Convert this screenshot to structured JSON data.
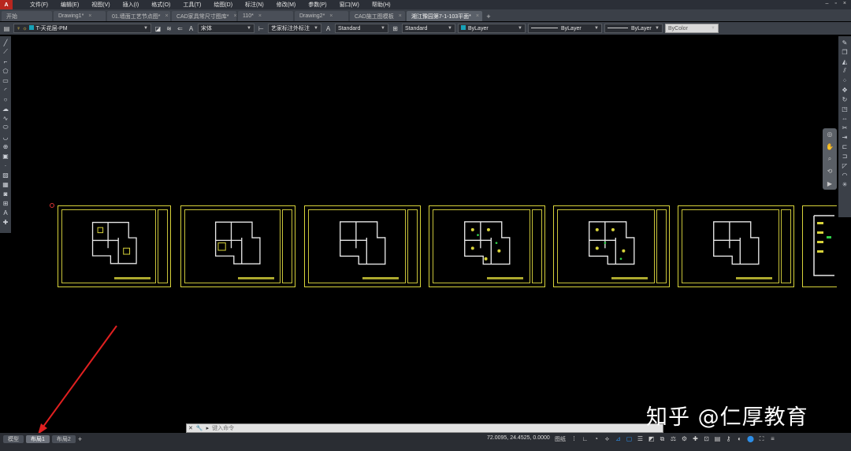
{
  "menubar": {
    "logo": "A",
    "items": [
      "文件(F)",
      "编辑(E)",
      "视图(V)",
      "插入(I)",
      "格式(O)",
      "工具(T)",
      "绘图(D)",
      "标注(N)",
      "修改(M)",
      "参数(P)",
      "窗口(W)",
      "帮助(H)"
    ],
    "window_controls": [
      "–",
      "▫",
      "×"
    ]
  },
  "tabs": {
    "items": [
      {
        "label": "开始",
        "width": 64
      },
      {
        "label": "Drawing1*",
        "width": 66
      },
      {
        "label": "01.墙面工艺节点图*",
        "width": 80
      },
      {
        "label": "CAD家具常尺寸图库*",
        "width": 82
      },
      {
        "label": "110*",
        "width": 70
      },
      {
        "label": "Drawing2*",
        "width": 68
      },
      {
        "label": "CAD施工图模板",
        "width": 70
      },
      {
        "label": "湘江豫园第7-1-103平面*",
        "width": 96,
        "active": true
      }
    ],
    "add": "+"
  },
  "toolbar": {
    "layer": "T-天花层-PM",
    "font": "宋体",
    "dimstyle": "艺家标注外标注",
    "textstyle": "Standard",
    "tablestyle": "Standard",
    "color": "ByLayer",
    "linetype": "ByLayer",
    "lineweight": "ByLayer",
    "plotstyle": "ByColor",
    "accent_layer_color": "#17a2b8"
  },
  "commandline": {
    "placeholder": "键入命令"
  },
  "statusbar": {
    "layout_tabs": [
      "模型",
      "布局1",
      "布局2"
    ],
    "active_layout": "布局1",
    "coords": "72.0095, 24.4525, 0.0000",
    "paper_label": "图纸"
  },
  "watermark": "知乎 @仁厚教育",
  "colors": {
    "canvas": "#000000",
    "sheet_border": "#d8d33a",
    "arrow": "#e02020",
    "ui_dark": "#2a2d33",
    "ui_mid": "#3b4048"
  }
}
